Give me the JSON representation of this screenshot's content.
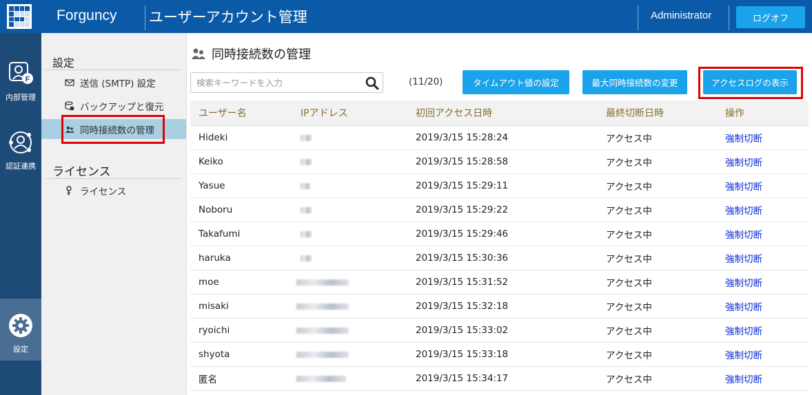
{
  "header": {
    "brand": "Forguncy",
    "title": "ユーザーアカウント管理",
    "user": "Administrator",
    "logout_label": "ログオフ"
  },
  "rail": {
    "items": [
      {
        "label": "内部管理",
        "icon": "user-card-icon"
      },
      {
        "label": "認証連携",
        "icon": "federation-icon"
      },
      {
        "label": "設定",
        "icon": "gear-icon",
        "active": true
      }
    ]
  },
  "sidebar": {
    "section1": "設定",
    "items1": [
      {
        "label": "送信 (SMTP) 設定",
        "icon": "mail-icon"
      },
      {
        "label": "バックアップと復元",
        "icon": "backup-icon"
      },
      {
        "label": "同時接続数の管理",
        "icon": "users-icon",
        "active": true
      }
    ],
    "section2": "ライセンス",
    "items2": [
      {
        "label": "ライセンス",
        "icon": "key-icon"
      }
    ]
  },
  "main": {
    "title": "同時接続数の管理",
    "search_placeholder": "検索キーワードを入力",
    "count": "(11/20)",
    "buttons": {
      "timeout": "タイムアウト値の設定",
      "max": "最大同時接続数の変更",
      "log": "アクセスログの表示"
    },
    "columns": [
      "ユーザー名",
      "IPアドレス",
      "初回アクセス日時",
      "最終切断日時",
      "操作"
    ],
    "rows": [
      {
        "user": "Hideki",
        "first": "2019/3/15 15:28:24",
        "last": "アクセス中",
        "action": "強制切断"
      },
      {
        "user": "Keiko",
        "first": "2019/3/15 15:28:58",
        "last": "アクセス中",
        "action": "強制切断"
      },
      {
        "user": "Yasue",
        "first": "2019/3/15 15:29:11",
        "last": "アクセス中",
        "action": "強制切断"
      },
      {
        "user": "Noboru",
        "first": "2019/3/15 15:29:22",
        "last": "アクセス中",
        "action": "強制切断"
      },
      {
        "user": "Takafumi",
        "first": "2019/3/15 15:29:46",
        "last": "アクセス中",
        "action": "強制切断"
      },
      {
        "user": "haruka",
        "first": "2019/3/15 15:30:36",
        "last": "アクセス中",
        "action": "強制切断"
      },
      {
        "user": "moe",
        "first": "2019/3/15 15:31:52",
        "last": "アクセス中",
        "action": "強制切断"
      },
      {
        "user": "misaki",
        "first": "2019/3/15 15:32:18",
        "last": "アクセス中",
        "action": "強制切断"
      },
      {
        "user": "ryoichi",
        "first": "2019/3/15 15:33:02",
        "last": "アクセス中",
        "action": "強制切断"
      },
      {
        "user": "shyota",
        "first": "2019/3/15 15:33:18",
        "last": "アクセス中",
        "action": "強制切断"
      },
      {
        "user": "匿名",
        "first": "2019/3/15 15:34:17",
        "last": "アクセス中",
        "action": "強制切断"
      }
    ]
  },
  "colors": {
    "header_bg": "#0a5aa8",
    "rail_bg": "#1e4a78",
    "button": "#1aa3ea",
    "highlight": "#e00000",
    "link": "#0b2bd6"
  }
}
